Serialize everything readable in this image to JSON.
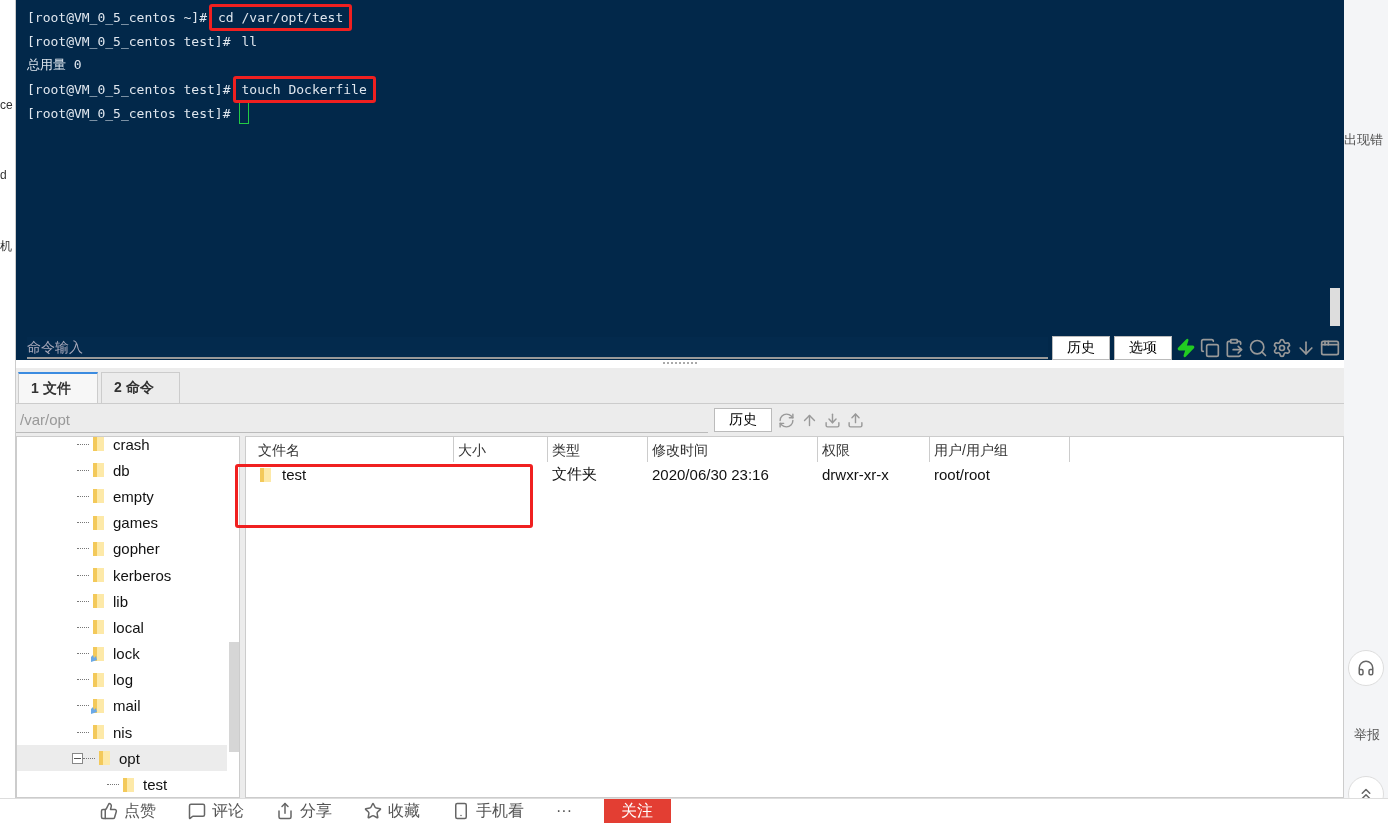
{
  "left_strip": {
    "fragments": [
      "ce",
      "d",
      "机"
    ]
  },
  "terminal": {
    "lines": [
      {
        "kind": "prompt",
        "prompt": "[root@VM_0_5_centos ~]#",
        "command": "cd /var/opt/test",
        "highlighted": true
      },
      {
        "kind": "prompt",
        "prompt": "[root@VM_0_5_centos test]#",
        "command": "ll",
        "highlighted": false
      },
      {
        "kind": "output",
        "text": "总用量 0"
      },
      {
        "kind": "prompt",
        "prompt": "[root@VM_0_5_centos test]#",
        "command": "touch Dockerfile",
        "highlighted": true
      },
      {
        "kind": "cursor",
        "prompt": "[root@VM_0_5_centos test]#"
      }
    ]
  },
  "command_bar": {
    "placeholder": "命令输入",
    "buttons": [
      "历史",
      "选项"
    ]
  },
  "tabs": [
    {
      "label": "1 文件",
      "selected": true
    },
    {
      "label": "2 命令",
      "selected": false
    }
  ],
  "path_bar": {
    "value": "/var/opt",
    "button": "历史"
  },
  "tree": {
    "items": [
      {
        "name": "crash",
        "kind": "folder",
        "selected": false
      },
      {
        "name": "db",
        "kind": "folder",
        "selected": false
      },
      {
        "name": "empty",
        "kind": "folder",
        "selected": false
      },
      {
        "name": "games",
        "kind": "folder",
        "selected": false
      },
      {
        "name": "gopher",
        "kind": "folder",
        "selected": false
      },
      {
        "name": "kerberos",
        "kind": "folder",
        "selected": false
      },
      {
        "name": "lib",
        "kind": "folder",
        "selected": false
      },
      {
        "name": "local",
        "kind": "folder",
        "selected": false
      },
      {
        "name": "lock",
        "kind": "link",
        "selected": false
      },
      {
        "name": "log",
        "kind": "folder",
        "selected": false
      },
      {
        "name": "mail",
        "kind": "link",
        "selected": false
      },
      {
        "name": "nis",
        "kind": "folder",
        "selected": false
      },
      {
        "name": "opt",
        "kind": "folder",
        "selected": true,
        "expanded": true,
        "children": [
          {
            "name": "test",
            "kind": "folder",
            "selected": false
          }
        ]
      }
    ]
  },
  "file_list": {
    "highlighted": true,
    "columns": [
      "文件名",
      "大小",
      "类型",
      "修改时间",
      "权限",
      "用户/用户组"
    ],
    "rows": [
      {
        "name": "test",
        "type": "文件夹",
        "modified": "2020/06/30 23:16",
        "permissions": "drwxr-xr-x",
        "owner": "root/root"
      }
    ]
  },
  "right_strip": {
    "texts": [
      "出现错",
      "举报"
    ]
  },
  "bottom_bar": {
    "actions": [
      {
        "kind": "like",
        "label": "点赞"
      },
      {
        "kind": "comment",
        "label": "评论"
      },
      {
        "kind": "share",
        "label": "分享"
      },
      {
        "kind": "star",
        "label": "收藏"
      },
      {
        "kind": "phone",
        "label": "手机看"
      },
      {
        "kind": "more",
        "label": "···"
      }
    ],
    "follow": "关注"
  }
}
